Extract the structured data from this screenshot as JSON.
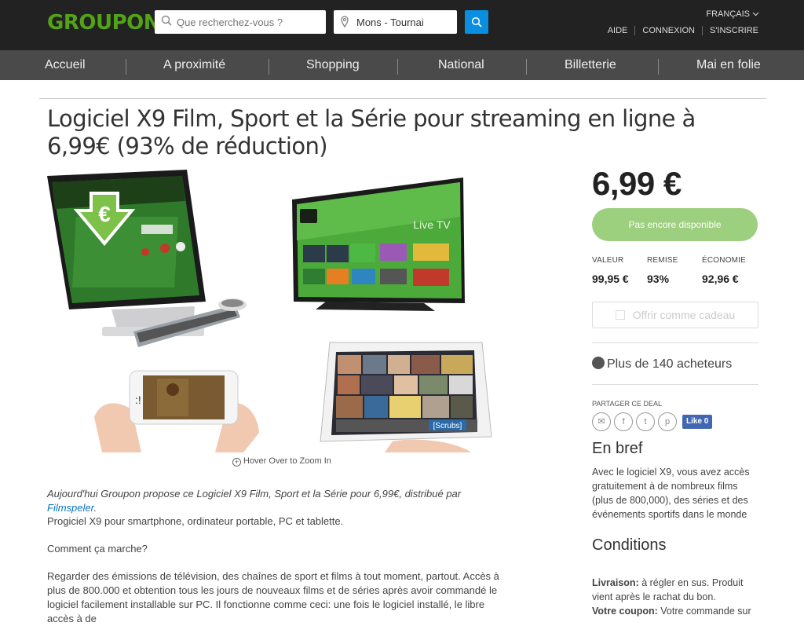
{
  "header": {
    "logo": "GROUPON",
    "search_placeholder": "Que recherchez-vous ?",
    "location": "Mons - Tournai",
    "language": "FRANÇAIS",
    "links": [
      "AIDE",
      "CONNEXION",
      "S'INSCRIRE"
    ]
  },
  "nav": [
    "Accueil",
    "A proximité",
    "Shopping",
    "National",
    "Billetterie",
    "Mai en folie"
  ],
  "deal": {
    "title": "Logiciel X9 Film, Sport et la Série pour streaming en ligne à 6,99€ (93% de réduction)",
    "zoom_hint": "Hover Over to Zoom In",
    "intro_prefix": "Aujourd'hui Groupon propose ce Logiciel X9 Film, Sport et la Série pour 6,99€, distribué par ",
    "intro_link": "Filmspeler",
    "intro_suffix": ".",
    "p1": "Progiciel X9 pour smartphone, ordinateur portable, PC et tablette.",
    "p2": "Comment ça marche?",
    "p3": "Regarder des émissions de télévision, des chaînes de sport et films à tout moment, partout. Accès à plus de 800.000 et obtention tous les jours de nouveaux films et de séries après avoir commandé le logiciel facilement installable sur PC. Il fonctionne comme ceci: une fois le logiciel installé, le libre accès à de"
  },
  "image": {
    "tv_label": "Live TV",
    "tablet_label": "[Scrubs]",
    "euro_symbol": "€"
  },
  "sidebar": {
    "price": "6,99 €",
    "cta": "Pas encore disponible",
    "stats": [
      {
        "label": "VALEUR",
        "value": "99,95 €"
      },
      {
        "label": "REMISE",
        "value": "93%"
      },
      {
        "label": "ÉCONOMIE",
        "value": "92,96 €"
      }
    ],
    "gift": "Offrir comme cadeau",
    "buyers": "Plus de 140 acheteurs",
    "share_label": "PARTAGER CE DEAL",
    "like": "Like 0",
    "brief_title": "En bref",
    "brief_text": "Avec le logiciel X9, vous avez accès gratuitement à de nombreux films (plus de 800,000), des séries et des événements sportifs dans le monde",
    "conditions_title": "Conditions",
    "cond1_label": "Livraison:",
    "cond1_text": " à régler en sus. Produit vient après le rachat du bon.",
    "cond2_label": "Votre coupon:",
    "cond2_text": " Votre commande sur"
  },
  "colors": {
    "brand": "#53a318",
    "header_bg": "#222222",
    "nav_bg": "#4a4a4a",
    "search_button": "#0a8fe0",
    "cta": "#9ccf7e"
  }
}
